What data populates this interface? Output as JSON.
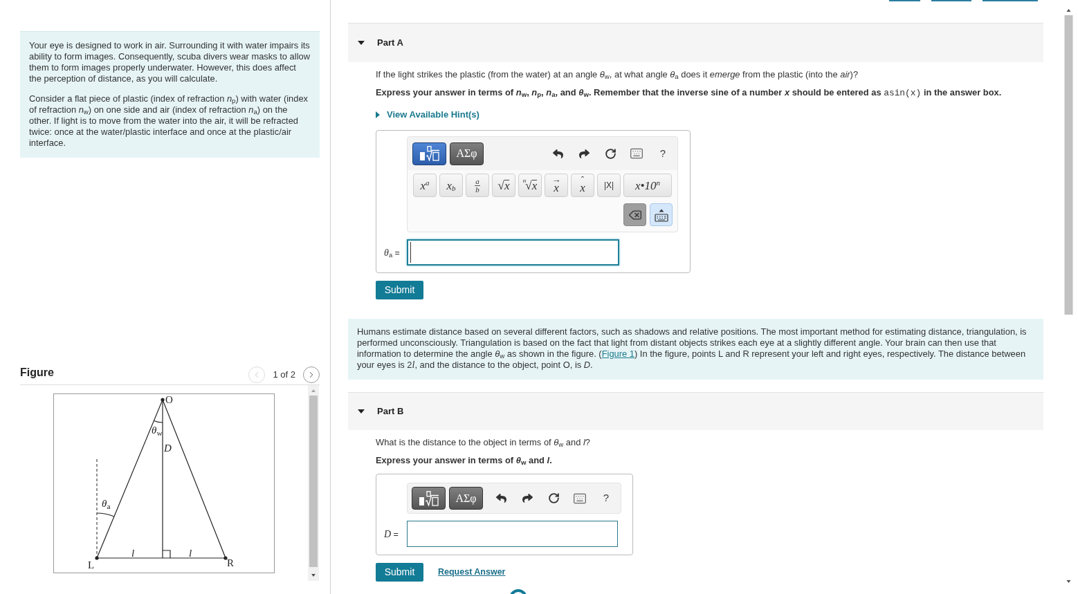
{
  "intro": {
    "paragraphs": [
      "Your eye is designed to work in air. Surrounding it with water impairs its ability to form images. Consequently, scuba divers wear masks to allow them to form images properly underwater. However, this does affect the perception of distance, as you will calculate.",
      "Consider a flat piece of plastic (index of refraction *n*$_{p}$) with water (index of refraction *n*$_{w}$) on one side and air (index of refraction *n*$_{a}$) on the other. If light is to move from the water into the air, it will be refracted twice: once at the water/plastic interface and once at the plastic/air interface."
    ]
  },
  "figure": {
    "title": "Figure",
    "pager": {
      "prev": {
        "disabled": true
      },
      "label": "1 of 2",
      "next": {
        "disabled": false
      }
    },
    "diagram": {
      "top_point": "O",
      "top_angle": "θ$_{w}$",
      "height": "D",
      "left_angle": "θ$_{a}$",
      "half_base": [
        "l",
        "l"
      ],
      "left_point": "L",
      "right_point": "R"
    }
  },
  "sections": [
    {
      "kind": "part",
      "title": "Part A",
      "expanded": true,
      "question": "If the light strikes the plastic (from the water) at an angle *θ*$_{w}$, at what angle *θ*$_{a}$ does it *emerge* from the plastic (into the *air*)?",
      "instruction": [
        {
          "kind": "text",
          "text": "Express your answer in terms of *n*$_{w}$, *n*$_{p}$, *n*$_{a}$, and *θ*$_{w}$. Remember that the inverse sine of a number *x* should be entered as "
        },
        {
          "kind": "code",
          "text": "asin(x)"
        },
        {
          "kind": "text",
          "text": " in the answer box."
        }
      ],
      "hint": {
        "label": "View Available Hint(s)",
        "expanded": false
      },
      "answer": {
        "toolbar": {
          "modes": [
            {
              "kind": "templates",
              "selected": true
            },
            {
              "kind": "symbols",
              "label": "ΑΣφ",
              "selected": false
            }
          ],
          "help": "?",
          "keys": [
            {
              "kind": "superscript",
              "base": "x",
              "sup": "a"
            },
            {
              "kind": "subscript",
              "base": "x",
              "sub": "b"
            },
            {
              "kind": "fraction",
              "numerator": "a",
              "denominator": "b"
            },
            {
              "kind": "root",
              "sign": "√",
              "radicand": "x"
            },
            {
              "kind": "nth_root",
              "index": "n",
              "sign": "√",
              "radicand": "x"
            },
            {
              "kind": "vector",
              "accent": "→",
              "base": "x"
            },
            {
              "kind": "hat",
              "accent": "ˆ",
              "base": "x"
            },
            {
              "kind": "absolute",
              "text": "|X|"
            },
            {
              "kind": "scientific",
              "base": "x•10",
              "sup": "n"
            }
          ]
        },
        "label": "*θ*$_{a}$ =",
        "focused": true
      },
      "buttons": [
        {
          "kind": "submit",
          "label": "Submit"
        }
      ]
    },
    {
      "kind": "context",
      "segments": [
        {
          "kind": "text",
          "text": "Humans estimate distance based on several different factors, such as shadows and relative positions. The most important method for estimating distance, triangulation, is performed unconsciously. Triangulation is based on the fact that light from distant objects strikes each eye at a slightly different angle. Your brain can then use that information to determine the angle *θ*$_{w}$ as shown in the figure. ("
        },
        {
          "kind": "link",
          "text": "Figure 1"
        },
        {
          "kind": "text",
          "text": ") In the figure, points L and R represent your left and right eyes, respectively. The distance between your eyes is 2"
        },
        {
          "kind": "math",
          "text": "l"
        },
        {
          "kind": "text",
          "text": ", and the distance to the object, point O, is *D*."
        }
      ]
    },
    {
      "kind": "part",
      "title": "Part B",
      "expanded": true,
      "question": "What is the distance to the object in terms of *θ*$_{w}$ and *l*?",
      "instruction": [
        {
          "kind": "text",
          "text": "Express your answer in terms of *θ*$_{w}$ and *l*."
        }
      ],
      "answer": {
        "toolbar": {
          "modes": [
            {
              "kind": "templates",
              "selected": false
            },
            {
              "kind": "symbols",
              "label": "ΑΣφ",
              "selected": false
            }
          ],
          "help": "?"
        },
        "label": "*D* =",
        "focused": false
      },
      "buttons": [
        {
          "kind": "submit",
          "label": "Submit"
        },
        {
          "kind": "link",
          "label": "Request Answer"
        }
      ]
    }
  ]
}
